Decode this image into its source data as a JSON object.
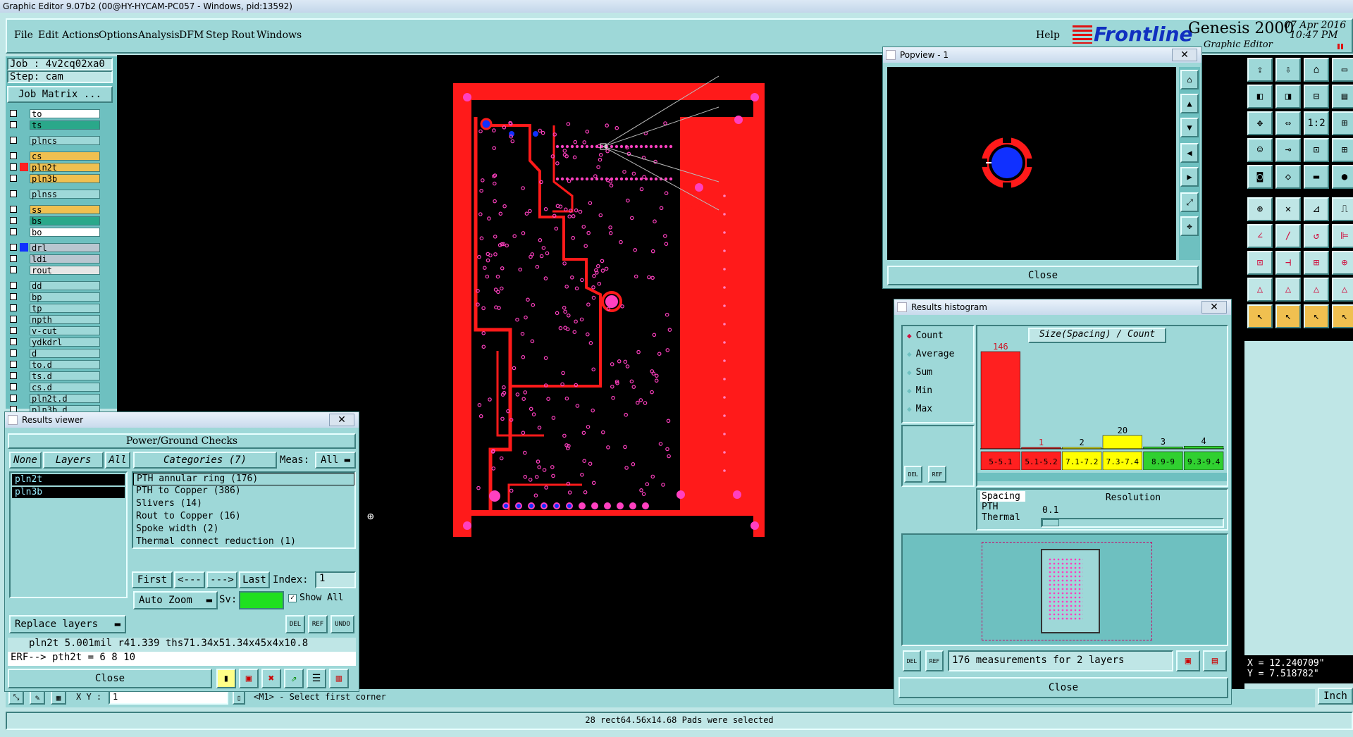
{
  "window": {
    "title": "Graphic Editor 9.07b2 (00@HY-HYCAM-PC057 - Windows, pid:13592)"
  },
  "menu": {
    "items": [
      "File",
      "Edit",
      "Actions",
      "Options",
      "Analysis",
      "DFM",
      "Step",
      "Rout",
      "Windows"
    ],
    "help": "Help"
  },
  "brand": {
    "logo": "Frontline",
    "product": "Genesis 2000",
    "subtitle": "Graphic Editor",
    "date": "07 Apr 2016",
    "time": "10:47 PM"
  },
  "job": {
    "job_label": "Job : 4v2cq02xa0",
    "step_label": "Step: cam",
    "matrix_button": "Job Matrix ..."
  },
  "layers": [
    {
      "name": "to",
      "color": "#ffffff",
      "swatch": ""
    },
    {
      "name": "ts",
      "color": "#2aa88a",
      "swatch": ""
    },
    {
      "name": "plncs",
      "color": "#9ed8d8",
      "swatch": ""
    },
    {
      "name": "cs",
      "color": "#f0c050",
      "swatch": ""
    },
    {
      "name": "pln2t",
      "color": "#f0c050",
      "swatch": "#ff2020"
    },
    {
      "name": "pln3b",
      "color": "#f0c050",
      "swatch": ""
    },
    {
      "name": "plnss",
      "color": "#9ed8d8",
      "swatch": ""
    },
    {
      "name": "ss",
      "color": "#f0c050",
      "swatch": ""
    },
    {
      "name": "bs",
      "color": "#2aa88a",
      "swatch": ""
    },
    {
      "name": "bo",
      "color": "#ffffff",
      "swatch": ""
    },
    {
      "name": "drl",
      "color": "#b9c6d0",
      "swatch": "#1030ff"
    },
    {
      "name": "ldi",
      "color": "#b9c6d0",
      "swatch": ""
    },
    {
      "name": "rout",
      "color": "#e6e6e6",
      "swatch": ""
    },
    {
      "name": "dd",
      "color": "#9ed8d8",
      "swatch": ""
    },
    {
      "name": "bp",
      "color": "#9ed8d8",
      "swatch": ""
    },
    {
      "name": "tp",
      "color": "#9ed8d8",
      "swatch": ""
    },
    {
      "name": "npth",
      "color": "#9ed8d8",
      "swatch": ""
    },
    {
      "name": "v-cut",
      "color": "#9ed8d8",
      "swatch": ""
    },
    {
      "name": "ydkdrl",
      "color": "#9ed8d8",
      "swatch": ""
    },
    {
      "name": "d",
      "color": "#9ed8d8",
      "swatch": ""
    },
    {
      "name": "to.d",
      "color": "#9ed8d8",
      "swatch": ""
    },
    {
      "name": "ts.d",
      "color": "#9ed8d8",
      "swatch": ""
    },
    {
      "name": "cs.d",
      "color": "#9ed8d8",
      "swatch": ""
    },
    {
      "name": "pln2t.d",
      "color": "#9ed8d8",
      "swatch": ""
    },
    {
      "name": "pln3b.d",
      "color": "#9ed8d8",
      "swatch": ""
    }
  ],
  "results_viewer": {
    "title": "Results viewer",
    "header": "Power/Ground Checks",
    "none_btn": "None",
    "layers_btn": "Layers",
    "all_btn": "All",
    "categories_label": "Categories (7)",
    "meas_label": "Meas:",
    "meas_value": "All",
    "layer_list": [
      "pln2t",
      "pln3b"
    ],
    "categories": [
      "PTH annular ring (176)",
      "PTH to Copper (386)",
      "Slivers (14)",
      "Rout to Copper (16)",
      "Spoke width (2)",
      "Thermal connect reduction (1)"
    ],
    "first": "First",
    "prev": "<---",
    "next": "--->",
    "last": "Last",
    "index_label": "Index:",
    "index_value": "1",
    "auto_zoom": "Auto Zoom",
    "sv_label": "Sv:",
    "show_all": "Show All",
    "replace_layers": "Replace layers",
    "del": "DEL",
    "ref": "REF",
    "undo": "UNDO",
    "measure_line": "pln2t 5.001mil  r41.339  ths71.34x51.34x45x4x10.8",
    "erf_line": "ERF--> pth2t = 6 8 10",
    "close": "Close"
  },
  "popview": {
    "title": "Popview - 1",
    "close": "Close"
  },
  "histogram": {
    "title": "Results histogram",
    "modes": [
      "Count",
      "Average",
      "Sum",
      "Min",
      "Max"
    ],
    "selected_mode": "Count",
    "chart_title": "Size(Spacing) / Count",
    "measure_types": [
      "Spacing",
      "PTH",
      "Thermal"
    ],
    "resolution_label": "Resolution",
    "resolution_value": "0.1",
    "summary": "176 measurements for 2 layers",
    "close": "Close",
    "del": "DEL",
    "ref": "REF"
  },
  "chart_data": {
    "type": "bar",
    "title": "Size(Spacing) / Count",
    "categories": [
      "5-5.1",
      "5.1-5.2",
      "7.1-7.2",
      "7.3-7.4",
      "8.9-9",
      "9.3-9.4"
    ],
    "values": [
      146,
      1,
      2,
      20,
      3,
      4
    ],
    "colors": [
      "#ff2020",
      "#ff2020",
      "#ffff00",
      "#ffff00",
      "#30d030",
      "#30d030"
    ]
  },
  "coords": {
    "x": "X = 12.240709\"",
    "y": "Y = 7.518782\"",
    "units": "Inch"
  },
  "status": {
    "xy_label": "X Y :",
    "xy_value": "1",
    "prompt": "<M1> - Select first corner",
    "message": "28 rect64.56x14.68 Pads were selected"
  }
}
